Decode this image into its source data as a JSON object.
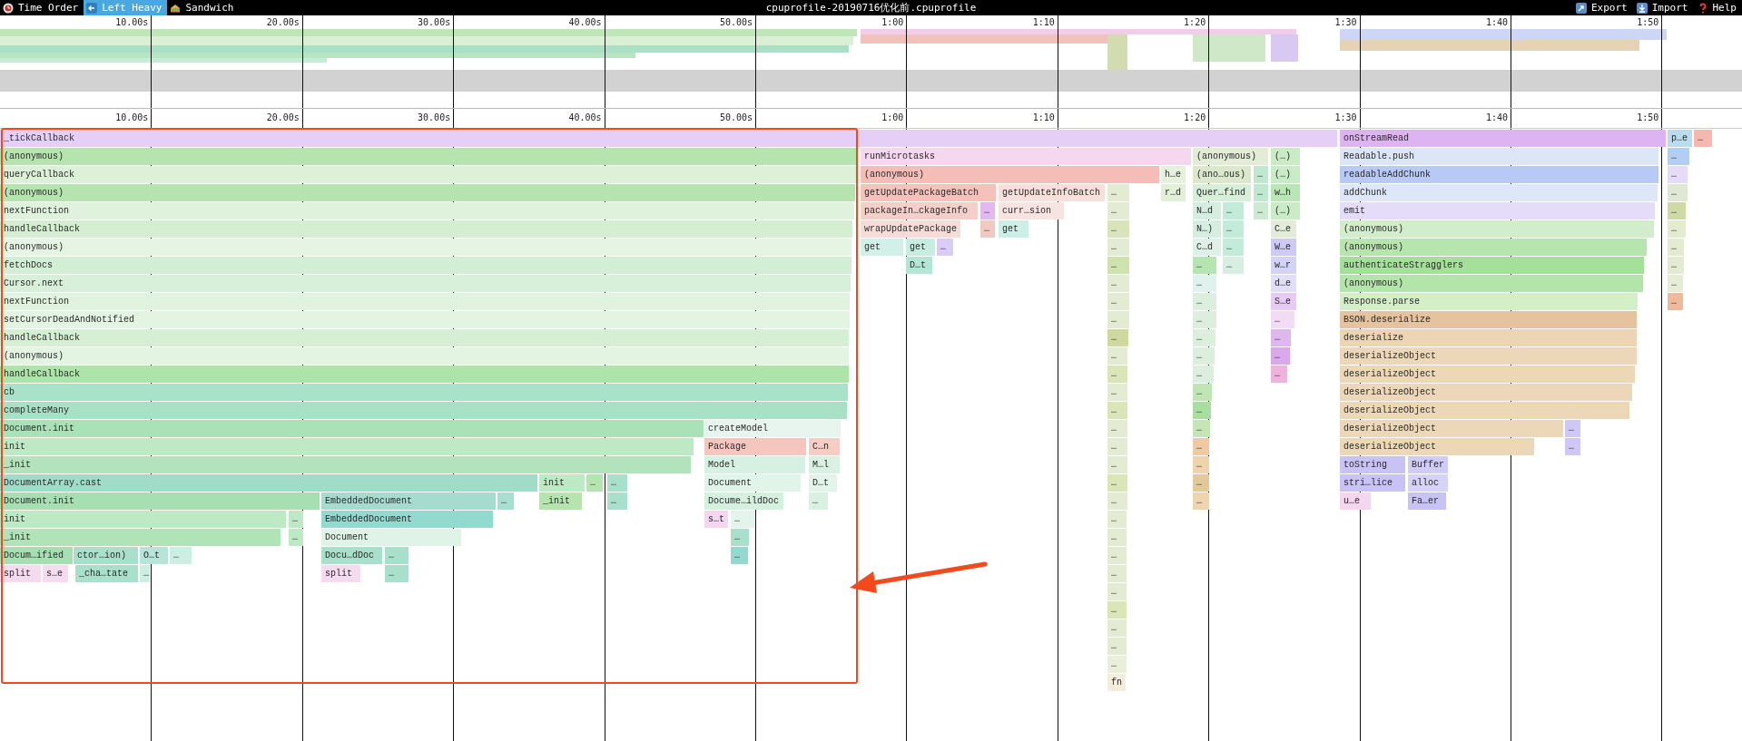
{
  "toolbar": {
    "view_tabs": [
      {
        "label": "Time Order",
        "selected": false
      },
      {
        "label": "Left Heavy",
        "selected": true
      },
      {
        "label": "Sandwich",
        "selected": false
      }
    ],
    "title": "cpuprofile-20190716优化前.cpuprofile",
    "actions": [
      {
        "label": "Export"
      },
      {
        "label": "Import"
      },
      {
        "label": "Help"
      }
    ]
  },
  "minimap": {
    "ticks": [
      "10.00s",
      "20.00s",
      "30.00s",
      "40.00s",
      "50.00s",
      "1:00",
      "1:10",
      "1:20",
      "1:30",
      "1:40",
      "1:50"
    ]
  },
  "ruler": {
    "ticks": [
      "10.00s",
      "20.00s",
      "30.00s",
      "40.00s",
      "50.00s",
      "1:00",
      "1:10",
      "1:20",
      "1:30",
      "1:40",
      "1:50"
    ]
  },
  "flame_graph": {
    "rows": [
      {
        "frames": [
          {
            "label": "_tickCallback",
            "color": "#e6cff7"
          },
          {
            "label": "onStreamRead",
            "color": "#ddb3f2"
          },
          {
            "label": "p…e",
            "color": "#b9dcef"
          },
          {
            "label": "…",
            "color": "#f4b8ae"
          }
        ]
      },
      {
        "frames": [
          {
            "label": "(anonymous)",
            "color": "#b6e4af"
          },
          {
            "label": "runMicrotasks",
            "color": "#f5d7f0"
          },
          {
            "label": "(anonymous)",
            "color": "#e2ecd6"
          },
          {
            "label": "(…)",
            "color": "#c9ecc6"
          },
          {
            "label": "Readable.push",
            "color": "#dce6f7"
          },
          {
            "label": "…",
            "color": "#b4cef2"
          }
        ]
      },
      {
        "frames": [
          {
            "label": "queryCallback",
            "color": "#dcf1d8"
          },
          {
            "label": "(anonymous)",
            "color": "#f5bdb8"
          },
          {
            "label": "h…e",
            "color": "#e6f1dd"
          },
          {
            "label": "(ano…ous)",
            "color": "#dbe8cc"
          },
          {
            "label": "…",
            "color": "#bfe8cf"
          },
          {
            "label": "(…)",
            "color": "#c9ecc6"
          },
          {
            "label": "readableAddChunk",
            "color": "#b8c9f5"
          },
          {
            "label": "…",
            "color": "#e6dcf8"
          }
        ]
      },
      {
        "frames": [
          {
            "label": "(anonymous)",
            "color": "#b6e4af"
          },
          {
            "label": "getUpdatePackageBatch",
            "color": "#f4c2bb"
          },
          {
            "label": "getUpdateInfoBatch",
            "color": "#f7e0dc"
          },
          {
            "label": "…",
            "color": "#e3ebd3"
          },
          {
            "label": "r…d",
            "color": "#e3efd9"
          },
          {
            "label": "Quer…find",
            "color": "#d7eed9"
          },
          {
            "label": "…",
            "color": "#bfe8cf"
          },
          {
            "label": "w…h",
            "color": "#b9e6b5"
          },
          {
            "label": "addChunk",
            "color": "#dde7f7"
          },
          {
            "label": "…",
            "color": "#dfe8d2"
          }
        ]
      },
      {
        "frames": [
          {
            "label": "nextFunction",
            "color": "#def2dc"
          },
          {
            "label": "packageIn…ckageInfo",
            "color": "#f4cfc9"
          },
          {
            "label": "…",
            "color": "#e3b8f2"
          },
          {
            "label": "curr…sion",
            "color": "#f7e4e1"
          },
          {
            "label": "…",
            "color": "#e3ebd3"
          },
          {
            "label": "N…d",
            "color": "#d5eedf"
          },
          {
            "label": "…",
            "color": "#c3ebd9"
          },
          {
            "label": "…",
            "color": "#cdebd0"
          },
          {
            "label": "(…)",
            "color": "#c9ecc6"
          },
          {
            "label": "emit",
            "color": "#e4dcf8"
          },
          {
            "label": "…",
            "color": "#cfd9a3"
          }
        ]
      },
      {
        "frames": [
          {
            "label": "handleCallback",
            "color": "#d5eed1"
          },
          {
            "label": "wrapUpdatePackage",
            "color": "#f6dcd9"
          },
          {
            "label": "…",
            "color": "#f2c9c1"
          },
          {
            "label": "get",
            "color": "#cdeee6"
          },
          {
            "label": "…",
            "color": "#d8e5b8"
          },
          {
            "label": "N…)",
            "color": "#d5eedf"
          },
          {
            "label": "…",
            "color": "#c3ebd9"
          },
          {
            "label": "C…e",
            "color": "#e3ecda"
          },
          {
            "label": "(anonymous)",
            "color": "#d1edc9"
          },
          {
            "label": "…",
            "color": "#e3ebd3"
          }
        ]
      },
      {
        "frames": [
          {
            "label": "(anonymous)",
            "color": "#e6f4e4"
          },
          {
            "label": "get",
            "color": "#d3f0e8"
          },
          {
            "label": "get",
            "color": "#c7ede1"
          },
          {
            "label": "…",
            "color": "#d9ccf7"
          },
          {
            "label": "…",
            "color": "#e3ebd3"
          },
          {
            "label": "C…d",
            "color": "#dff1e6"
          },
          {
            "label": "…",
            "color": "#c3ebd9"
          },
          {
            "label": "W…e",
            "color": "#cdcaf6"
          },
          {
            "label": "(anonymous)",
            "color": "#b7e5ae"
          },
          {
            "label": "…",
            "color": "#e3ebd3"
          }
        ]
      },
      {
        "frames": [
          {
            "label": "fetchDocs",
            "color": "#d2efd5"
          },
          {
            "label": "D…t",
            "color": "#b3e6d5"
          },
          {
            "label": "…",
            "color": "#cfe3ae"
          },
          {
            "label": "…",
            "color": "#b5e5b0"
          },
          {
            "label": "…",
            "color": "#d7efe0"
          },
          {
            "label": "w…r",
            "color": "#d3d3f6"
          },
          {
            "label": "authenticateStragglers",
            "color": "#a5e09a"
          },
          {
            "label": "…",
            "color": "#e3ebd3"
          }
        ]
      },
      {
        "frames": [
          {
            "label": "Cursor.next",
            "color": "#d8f0da"
          },
          {
            "label": "…",
            "color": "#e3ebd3"
          },
          {
            "label": "…",
            "color": "#e0f2ee"
          },
          {
            "label": "d…e",
            "color": "#e1defa"
          },
          {
            "label": "(anonymous)",
            "color": "#b3e4aa"
          },
          {
            "label": "…",
            "color": "#e6ecd6"
          }
        ]
      },
      {
        "frames": [
          {
            "label": "nextFunction",
            "color": "#e0f3de"
          },
          {
            "label": "…",
            "color": "#e3ebd3"
          },
          {
            "label": "…",
            "color": "#dceedd"
          },
          {
            "label": "S…e",
            "color": "#e8cbf5"
          },
          {
            "label": "Response.parse",
            "color": "#d3eec9"
          },
          {
            "label": "…",
            "color": "#f0b99a"
          }
        ]
      },
      {
        "frames": [
          {
            "label": "setCursorDeadAndNotified",
            "color": "#e3f4e2"
          },
          {
            "label": "…",
            "color": "#e3ebd3"
          },
          {
            "label": "…",
            "color": "#dceedd"
          },
          {
            "label": "…",
            "color": "#f2dcf5"
          },
          {
            "label": "BSON.deserialize",
            "color": "#e6c39f"
          }
        ]
      },
      {
        "frames": [
          {
            "label": "handleCallback",
            "color": "#d6efd4"
          },
          {
            "label": "…",
            "color": "#cfd99e"
          },
          {
            "label": "…",
            "color": "#dceedd"
          },
          {
            "label": "…",
            "color": "#dfb7ef"
          },
          {
            "label": "deserialize",
            "color": "#ecd5b4"
          }
        ]
      },
      {
        "frames": [
          {
            "label": "(anonymous)",
            "color": "#e4f4e2"
          },
          {
            "label": "…",
            "color": "#e3ebd3"
          },
          {
            "label": "…",
            "color": "#dceedd"
          },
          {
            "label": "…",
            "color": "#d9a9ec"
          },
          {
            "label": "deserializeObject",
            "color": "#ecd8b9"
          }
        ]
      },
      {
        "frames": [
          {
            "label": "handleCallback",
            "color": "#aee4a9"
          },
          {
            "label": "…",
            "color": "#dbe6b8"
          },
          {
            "label": "…",
            "color": "#dceedd"
          },
          {
            "label": "…",
            "color": "#f0b3dd"
          },
          {
            "label": "deserializeObject",
            "color": "#ecd8b9"
          }
        ]
      },
      {
        "frames": [
          {
            "label": "cb",
            "color": "#a8e2c8"
          },
          {
            "label": "…",
            "color": "#e3ebd3"
          },
          {
            "label": "…",
            "color": "#bfe6b4"
          },
          {
            "label": "deserializeObject",
            "color": "#ecd8b9"
          }
        ]
      },
      {
        "frames": [
          {
            "label": "completeMany",
            "color": "#a9e1c6"
          },
          {
            "label": "…",
            "color": "#dbe6b8"
          },
          {
            "label": "…",
            "color": "#a8dea0"
          },
          {
            "label": "deserializeObject",
            "color": "#ecd8b9"
          }
        ]
      },
      {
        "frames": [
          {
            "label": "Document.init",
            "color": "#a9e2b7"
          },
          {
            "label": "createModel",
            "color": "#e8f5ef"
          },
          {
            "label": "…",
            "color": "#e3ebd3"
          },
          {
            "label": "…",
            "color": "#c5e5b5"
          },
          {
            "label": "deserializeObject",
            "color": "#ecd8b9"
          },
          {
            "label": "…",
            "color": "#cfc8f7"
          }
        ]
      },
      {
        "frames": [
          {
            "label": "init",
            "color": "#bfe8c5"
          },
          {
            "label": "Package",
            "color": "#f5c6be"
          },
          {
            "label": "C…n",
            "color": "#f5cdc5"
          },
          {
            "label": "…",
            "color": "#e3ebd3"
          },
          {
            "label": "…",
            "color": "#efc9a4"
          },
          {
            "label": "deserializeObject",
            "color": "#ecd8b9"
          },
          {
            "label": "…",
            "color": "#cfc8f7"
          }
        ]
      },
      {
        "frames": [
          {
            "label": "_init",
            "color": "#b2e3bd"
          },
          {
            "label": "Model",
            "color": "#d6f0e1"
          },
          {
            "label": "M…l",
            "color": "#d9f0e2"
          },
          {
            "label": "…",
            "color": "#e3ebd3"
          },
          {
            "label": "…",
            "color": "#eed3ad"
          },
          {
            "label": "toString",
            "color": "#c9c2f5"
          },
          {
            "label": "Buffer",
            "color": "#d0cbf7"
          }
        ]
      },
      {
        "frames": [
          {
            "label": "DocumentArray.cast",
            "color": "#a0dcc8"
          },
          {
            "label": "init",
            "color": "#bde9c4"
          },
          {
            "label": "…",
            "color": "#b6e4af"
          },
          {
            "label": "…",
            "color": "#a8e0cc"
          },
          {
            "label": "Document",
            "color": "#e0f4e8"
          },
          {
            "label": "D…t",
            "color": "#e3f5ea"
          },
          {
            "label": "…",
            "color": "#dbe6b8"
          },
          {
            "label": "…",
            "color": "#e3c99a"
          },
          {
            "label": "stri…lice",
            "color": "#c9c2f5"
          },
          {
            "label": "alloc",
            "color": "#d6d3f6"
          }
        ]
      },
      {
        "frames": [
          {
            "label": "Document.init",
            "color": "#a6e0b2"
          },
          {
            "label": "EmbeddedDocument",
            "color": "#a6dccf"
          },
          {
            "label": "…",
            "color": "#a8dfd0"
          },
          {
            "label": "_init",
            "color": "#b6e4af"
          },
          {
            "label": "…",
            "color": "#a8e0cc"
          },
          {
            "label": "Docume…ildDoc",
            "color": "#d6f0e0"
          },
          {
            "label": "…",
            "color": "#d9f0e3"
          },
          {
            "label": "…",
            "color": "#e3ebd3"
          },
          {
            "label": "…",
            "color": "#efd5ad"
          },
          {
            "label": "u…e",
            "color": "#f5d6ee"
          },
          {
            "label": "Fa…er",
            "color": "#c7c3f5"
          }
        ]
      },
      {
        "frames": [
          {
            "label": "init",
            "color": "#bde9c4"
          },
          {
            "label": "…",
            "color": "#bde9c4"
          },
          {
            "label": "EmbeddedDocument",
            "color": "#93d9cf"
          },
          {
            "label": "s…t",
            "color": "#f4d6f0"
          },
          {
            "label": "…",
            "color": "#e3f5ea"
          },
          {
            "label": "…",
            "color": "#e3ebd3"
          }
        ]
      },
      {
        "frames": [
          {
            "label": "_init",
            "color": "#b0e4b8"
          },
          {
            "label": "…",
            "color": "#bde9c4"
          },
          {
            "label": "Document",
            "color": "#dff4e6"
          },
          {
            "label": "…",
            "color": "#a8e0cc"
          },
          {
            "label": "…",
            "color": "#e3ebd3"
          }
        ]
      },
      {
        "frames": [
          {
            "label": "Docum…ified",
            "color": "#a6e0b2"
          },
          {
            "label": "ctor…ion)",
            "color": "#a8e0cc"
          },
          {
            "label": "O…t",
            "color": "#b6e4d6"
          },
          {
            "label": "…",
            "color": "#cfeee3"
          },
          {
            "label": "Docu…dDoc",
            "color": "#a8e0cc"
          },
          {
            "label": "…",
            "color": "#a8e0cc"
          },
          {
            "label": "…",
            "color": "#93d9cf"
          },
          {
            "label": "…",
            "color": "#e3ebd3"
          }
        ]
      },
      {
        "frames": [
          {
            "label": "split",
            "color": "#f5dbf0"
          },
          {
            "label": "s…e",
            "color": "#f5dbf0"
          },
          {
            "label": "_cha…tate",
            "color": "#a8e0cc"
          },
          {
            "label": "…",
            "color": "#cfeee3"
          },
          {
            "label": "split",
            "color": "#f5dbf0"
          },
          {
            "label": "…",
            "color": "#a8e0cc"
          },
          {
            "label": "…",
            "color": "#e3ebd3"
          }
        ]
      },
      {
        "frames": [
          {
            "label": "…",
            "color": "#e3ebd3"
          }
        ]
      },
      {
        "frames": [
          {
            "label": "…",
            "color": "#dbe6b8"
          }
        ]
      },
      {
        "frames": [
          {
            "label": "…",
            "color": "#e3ebd3"
          }
        ]
      },
      {
        "frames": [
          {
            "label": "…",
            "color": "#e3ebd3"
          }
        ]
      },
      {
        "frames": [
          {
            "label": "…",
            "color": "#eaefdc"
          }
        ]
      },
      {
        "frames": [
          {
            "label": "fn",
            "color": "#f3eedc"
          }
        ]
      }
    ]
  }
}
